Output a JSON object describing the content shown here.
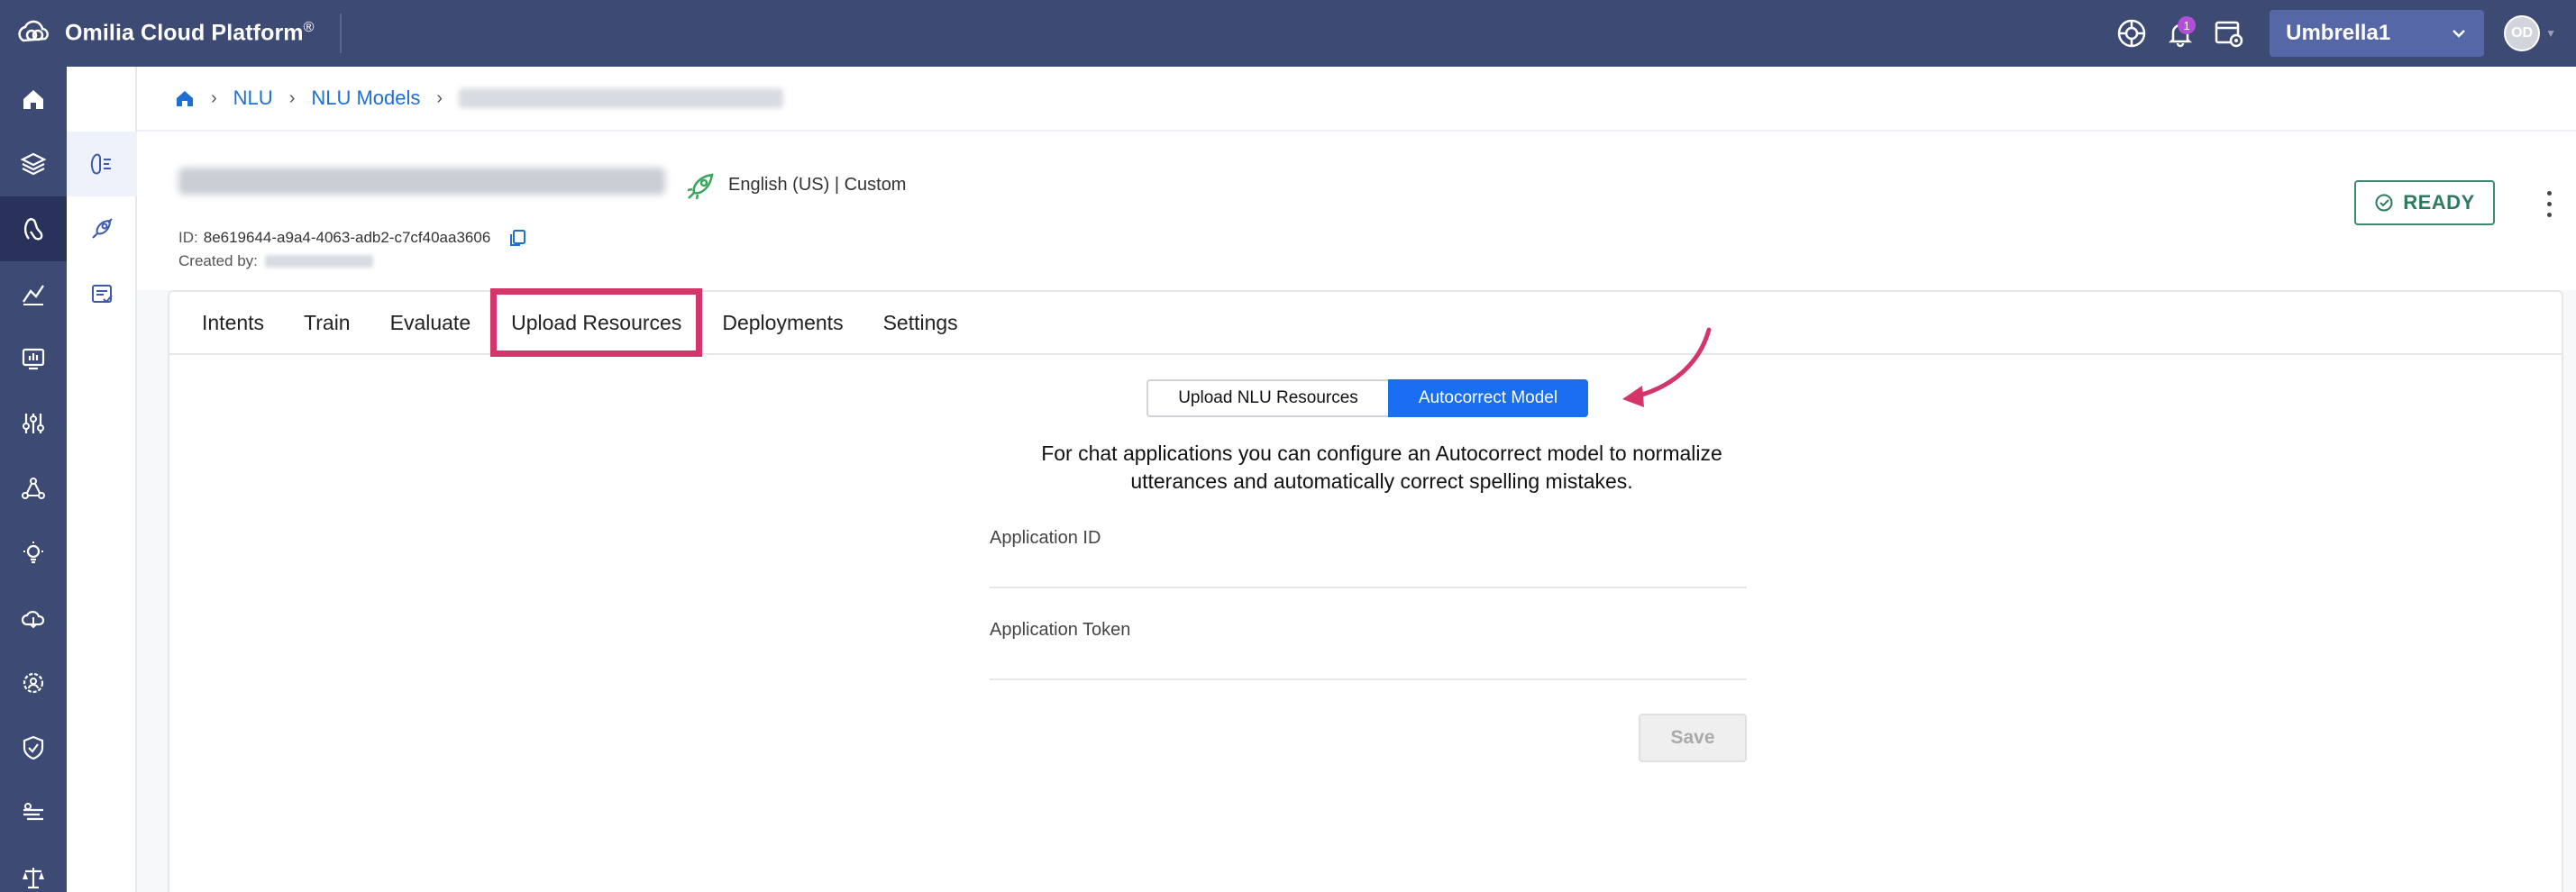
{
  "app": {
    "brand_name": "Omilia Cloud Platform",
    "brand_mark": "®"
  },
  "topbar": {
    "notification_count": "1",
    "organization": "Umbrella1",
    "user_initials": "OD"
  },
  "breadcrumb": {
    "items": [
      "NLU",
      "NLU Models"
    ]
  },
  "model": {
    "language_info": "English (US) | Custom",
    "id_label": "ID:",
    "id_value": "8e619644-a9a4-4063-adb2-c7cf40aa3606",
    "created_by_label": "Created by:",
    "status": "READY"
  },
  "tabs": [
    {
      "label": "Intents"
    },
    {
      "label": "Train"
    },
    {
      "label": "Evaluate"
    },
    {
      "label": "Upload Resources"
    },
    {
      "label": "Deployments"
    },
    {
      "label": "Settings"
    }
  ],
  "upload_section": {
    "toggle_left": "Upload NLU Resources",
    "toggle_right": "Autocorrect Model",
    "active_toggle": "Autocorrect Model",
    "description": "For chat applications you can configure an Autocorrect model to normalize utterances and automatically correct spelling mistakes.",
    "app_id_label": "Application ID",
    "app_id_value": "",
    "app_token_label": "Application Token",
    "app_token_value": "",
    "save_label": "Save"
  },
  "colors": {
    "topbar_bg": "#3d4a74",
    "accent_blue": "#1a6ef2",
    "highlight_pink": "#d5366a",
    "ready_green": "#2f7b61"
  },
  "icons": {
    "leftnav": [
      "home-icon",
      "layers-icon",
      "nlu-icon",
      "analytics-icon",
      "monitor-icon",
      "sliders-icon",
      "graph-icon",
      "lightbulb-icon",
      "cloud-icon",
      "gear-person-icon",
      "shield-gear-icon",
      "speech-icon",
      "scale-icon"
    ],
    "subnav": [
      "model-icon",
      "rocket-icon",
      "evaluate-icon"
    ]
  }
}
